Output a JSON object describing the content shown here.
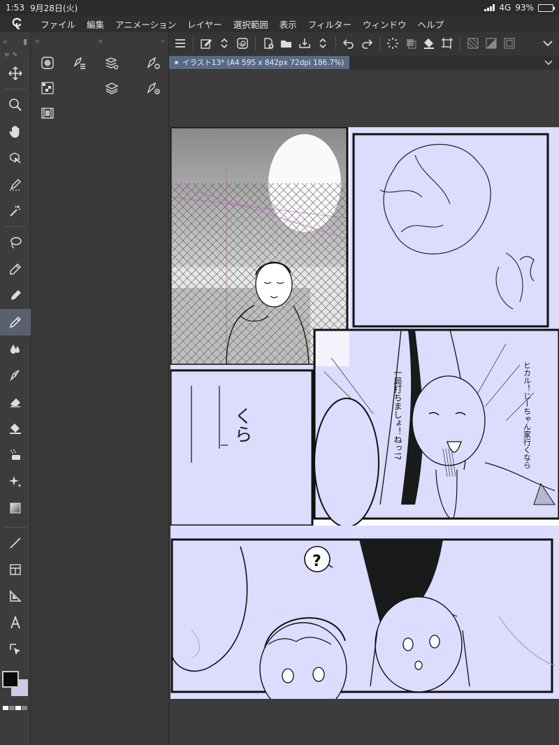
{
  "status_bar": {
    "time": "1:53",
    "date": "9月28日(火)",
    "network": "4G",
    "battery": "93%",
    "battery_level": 0.93
  },
  "menu": {
    "items": [
      "ファイル",
      "編集",
      "アニメーション",
      "レイヤー",
      "選択範囲",
      "表示",
      "フィルター",
      "ウィンドウ",
      "ヘルプ"
    ]
  },
  "document": {
    "tab_label": "イラスト13* (A4 595 x 842px 72dpi 186.7%)"
  },
  "tools": {
    "items": [
      "move-icon",
      "zoom-icon",
      "hand-icon",
      "object-select-icon",
      "select-pen-icon",
      "magic-wand-icon",
      "lasso-icon",
      "eyedropper-icon",
      "pen-nib-icon",
      "pencil-icon",
      "blend-icon",
      "airbrush-pen-icon",
      "eraser-icon",
      "fill-bucket-icon",
      "spray-icon",
      "sparkle-icon",
      "gradient-icon",
      "line-icon",
      "frame-border-icon",
      "ruler-icon",
      "text-icon",
      "operation-icon"
    ],
    "active": "pencil-icon",
    "colors": {
      "main": "#0a0a0a",
      "sub": "#c9cce8"
    }
  },
  "manga_text": {
    "sfx_kura": "くら",
    "speech_1": "一局打ちましょ！ねっ!?",
    "speech_2": "ヒカル！じーちゃん家行くなら",
    "question": "?"
  },
  "colors": {
    "panel_bg": "#dcdcff",
    "page_bg": "#ffffff",
    "accent_tab": "#5a6a85"
  }
}
